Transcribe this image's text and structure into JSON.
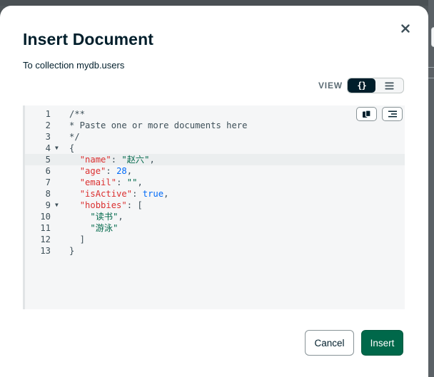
{
  "modal": {
    "title": "Insert Document",
    "subtitle": "To collection mydb.users",
    "close_icon": "close-icon"
  },
  "view_toggle": {
    "label": "VIEW",
    "options": [
      {
        "name": "json-view",
        "icon": "curly-braces-icon",
        "glyph": "{}",
        "active": true
      },
      {
        "name": "list-view",
        "icon": "list-icon",
        "active": false
      }
    ]
  },
  "editor": {
    "tools": [
      {
        "name": "copy-button",
        "icon": "copy-icon"
      },
      {
        "name": "format-button",
        "icon": "format-icon"
      }
    ],
    "lines": [
      {
        "num": "1",
        "fold": false,
        "tokens": [
          {
            "t": "/**",
            "c": "comment"
          }
        ]
      },
      {
        "num": "2",
        "fold": false,
        "tokens": [
          {
            "t": "* Paste one or more documents here",
            "c": "comment"
          }
        ]
      },
      {
        "num": "3",
        "fold": false,
        "tokens": [
          {
            "t": "*/",
            "c": "comment"
          }
        ]
      },
      {
        "num": "4",
        "fold": true,
        "tokens": [
          {
            "t": "{",
            "c": "punc"
          }
        ]
      },
      {
        "num": "5",
        "fold": false,
        "tokens": [
          {
            "t": "  ",
            "c": "punc"
          },
          {
            "t": "\"name\"",
            "c": "key"
          },
          {
            "t": ": ",
            "c": "punc"
          },
          {
            "t": "\"赵六\"",
            "c": "str"
          },
          {
            "t": ",",
            "c": "punc"
          }
        ]
      },
      {
        "num": "6",
        "fold": false,
        "tokens": [
          {
            "t": "  ",
            "c": "punc"
          },
          {
            "t": "\"age\"",
            "c": "key"
          },
          {
            "t": ": ",
            "c": "punc"
          },
          {
            "t": "28",
            "c": "num"
          },
          {
            "t": ",",
            "c": "punc"
          }
        ]
      },
      {
        "num": "7",
        "fold": false,
        "tokens": [
          {
            "t": "  ",
            "c": "punc"
          },
          {
            "t": "\"email\"",
            "c": "key"
          },
          {
            "t": ": ",
            "c": "punc"
          },
          {
            "t": "\"\"",
            "c": "str"
          },
          {
            "t": ",",
            "c": "punc"
          }
        ]
      },
      {
        "num": "8",
        "fold": false,
        "tokens": [
          {
            "t": "  ",
            "c": "punc"
          },
          {
            "t": "\"isActive\"",
            "c": "key"
          },
          {
            "t": ": ",
            "c": "punc"
          },
          {
            "t": "true",
            "c": "bool"
          },
          {
            "t": ",",
            "c": "punc"
          }
        ]
      },
      {
        "num": "9",
        "fold": true,
        "tokens": [
          {
            "t": "  ",
            "c": "punc"
          },
          {
            "t": "\"hobbies\"",
            "c": "key"
          },
          {
            "t": ": [",
            "c": "punc"
          }
        ]
      },
      {
        "num": "10",
        "fold": false,
        "tokens": [
          {
            "t": "    ",
            "c": "punc"
          },
          {
            "t": "\"读书\"",
            "c": "str"
          },
          {
            "t": ",",
            "c": "punc"
          }
        ]
      },
      {
        "num": "11",
        "fold": false,
        "tokens": [
          {
            "t": "    ",
            "c": "punc"
          },
          {
            "t": "\"游泳\"",
            "c": "str"
          }
        ]
      },
      {
        "num": "12",
        "fold": false,
        "tokens": [
          {
            "t": "  ]",
            "c": "punc"
          }
        ]
      },
      {
        "num": "13",
        "fold": false,
        "tokens": [
          {
            "t": "}",
            "c": "punc"
          }
        ]
      }
    ]
  },
  "footer": {
    "cancel_label": "Cancel",
    "insert_label": "Insert"
  },
  "colors": {
    "primary": "#00684a",
    "title": "#001e2b",
    "json_key": "#db3030",
    "json_string": "#00684a",
    "json_number": "#016bf8"
  }
}
